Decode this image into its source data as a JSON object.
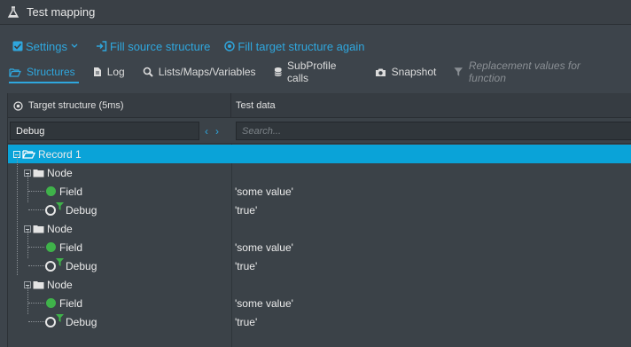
{
  "window": {
    "title": "Test mapping"
  },
  "toolbar": {
    "settings": "Settings",
    "fill_source": "Fill source structure",
    "fill_target": "Fill target structure again"
  },
  "tabs": [
    {
      "label": "Structures"
    },
    {
      "label": "Log"
    },
    {
      "label": "Lists/Maps/Variables"
    },
    {
      "label": "SubProfile calls"
    },
    {
      "label": "Snapshot"
    },
    {
      "label": "Replacement values for function"
    }
  ],
  "columns": {
    "target": "Target structure (5ms)",
    "testdata": "Test data"
  },
  "filter": {
    "value": "Debug",
    "search_placeholder": "Search..."
  },
  "tree": {
    "root": "Record 1",
    "nodes": [
      {
        "label": "Node",
        "field_label": "Field",
        "field_value": "'some value'",
        "debug_label": "Debug",
        "debug_value": "'true'"
      },
      {
        "label": "Node",
        "field_label": "Field",
        "field_value": "'some value'",
        "debug_label": "Debug",
        "debug_value": "'true'"
      },
      {
        "label": "Node",
        "field_label": "Field",
        "field_value": "'some value'",
        "debug_label": "Debug",
        "debug_value": "'true'"
      }
    ]
  },
  "colors": {
    "accent": "#2fa7de",
    "selection": "#0aa3d8",
    "field_dot": "#3fb24a"
  }
}
